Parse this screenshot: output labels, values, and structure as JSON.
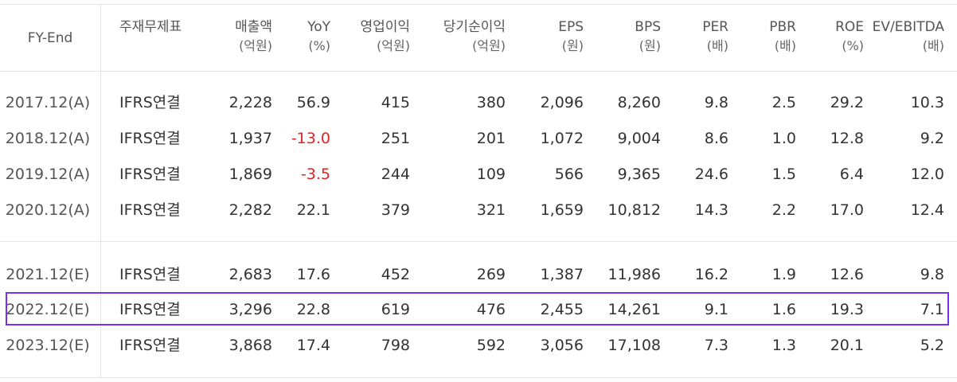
{
  "headers": [
    {
      "title": "FY-End",
      "sub": ""
    },
    {
      "title": "주재무제표",
      "sub": ""
    },
    {
      "title": "매출액",
      "sub": "(억원)"
    },
    {
      "title": "YoY",
      "sub": "(%)"
    },
    {
      "title": "영업이익",
      "sub": "(억원)"
    },
    {
      "title": "당기순이익",
      "sub": "(억원)"
    },
    {
      "title": "EPS",
      "sub": "(원)"
    },
    {
      "title": "BPS",
      "sub": "(원)"
    },
    {
      "title": "PER",
      "sub": "(배)"
    },
    {
      "title": "PBR",
      "sub": "(배)"
    },
    {
      "title": "ROE",
      "sub": "(%)"
    },
    {
      "title": "EV/EBITDA",
      "sub": "(배)"
    }
  ],
  "rows": [
    [
      "2017.12(A)",
      "IFRS연결",
      "2,228",
      "56.9",
      "415",
      "380",
      "2,096",
      "8,260",
      "9.8",
      "2.5",
      "29.2",
      "10.3"
    ],
    [
      "2018.12(A)",
      "IFRS연결",
      "1,937",
      "-13.0",
      "251",
      "201",
      "1,072",
      "9,004",
      "8.6",
      "1.0",
      "12.8",
      "9.2"
    ],
    [
      "2019.12(A)",
      "IFRS연결",
      "1,869",
      "-3.5",
      "244",
      "109",
      "566",
      "9,365",
      "24.6",
      "1.5",
      "6.4",
      "12.0"
    ],
    [
      "2020.12(A)",
      "IFRS연결",
      "2,282",
      "22.1",
      "379",
      "321",
      "1,659",
      "10,812",
      "14.3",
      "2.2",
      "17.0",
      "12.4"
    ],
    [
      "2021.12(E)",
      "IFRS연결",
      "2,683",
      "17.6",
      "452",
      "269",
      "1,387",
      "11,986",
      "16.2",
      "1.9",
      "12.6",
      "9.8"
    ],
    [
      "2022.12(E)",
      "IFRS연결",
      "3,296",
      "22.8",
      "619",
      "476",
      "2,455",
      "14,261",
      "9.1",
      "1.6",
      "19.3",
      "7.1"
    ],
    [
      "2023.12(E)",
      "IFRS연결",
      "3,868",
      "17.4",
      "798",
      "592",
      "3,056",
      "17,108",
      "7.3",
      "1.3",
      "20.1",
      "5.2"
    ]
  ],
  "colors": {
    "negative": "#e02424",
    "highlight_border": "#7b2ff0"
  },
  "highlighted_row": "2022.12(E)"
}
